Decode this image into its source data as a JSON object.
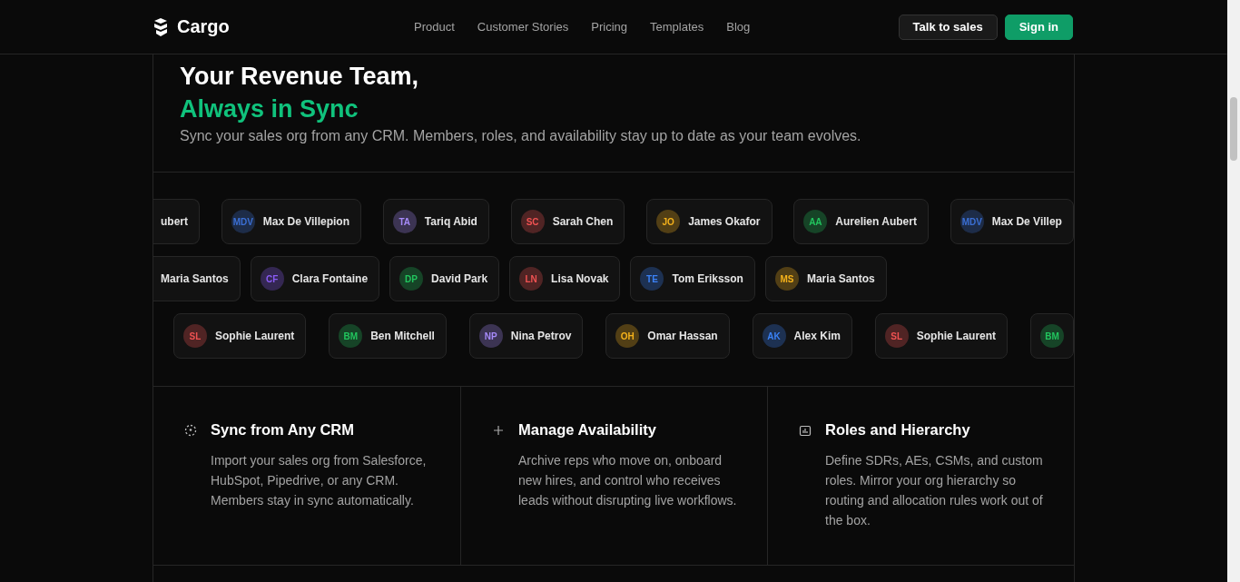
{
  "nav": {
    "brand": "Cargo",
    "links": [
      "Product",
      "Customer Stories",
      "Pricing",
      "Templates",
      "Blog"
    ],
    "buttons": [
      {
        "label": "Talk to sales",
        "kind": "secondary"
      },
      {
        "label": "Sign in",
        "kind": "primary"
      }
    ]
  },
  "hero": {
    "title": "Your Revenue Team,",
    "highlight": "Always in Sync",
    "subtitle": "Sync your sales org from any CRM. Members, roles, and availability stay up to date as your team evolves."
  },
  "member_rows": [
    [
      {
        "name": "ubert"
      },
      {
        "initials": "MDV",
        "name": "Max De Villepion",
        "color": "#3b6fd4"
      },
      {
        "initials": "TA",
        "name": "Tariq Abid",
        "color": "#a78bfa"
      },
      {
        "initials": "SC",
        "name": "Sarah Chen",
        "color": "#f05252"
      },
      {
        "initials": "JO",
        "name": "James Okafor",
        "color": "#f5b21b"
      },
      {
        "initials": "AA",
        "name": "Aurelien Aubert",
        "color": "#22c55e"
      },
      {
        "initials": "MDV",
        "name": "Max De Villep",
        "color": "#3b6fd4"
      }
    ],
    [
      {
        "name": "Maria Santos"
      },
      {
        "initials": "CF",
        "name": "Clara Fontaine",
        "color": "#8b5cf6"
      },
      {
        "initials": "DP",
        "name": "David Park",
        "color": "#22c55e"
      },
      {
        "initials": "LN",
        "name": "Lisa Novak",
        "color": "#f05252"
      },
      {
        "initials": "TE",
        "name": "Tom Eriksson",
        "color": "#3b82f6"
      },
      {
        "initials": "MS",
        "name": "Maria Santos",
        "color": "#f5b21b"
      }
    ],
    [
      {
        "initials": "SL",
        "name": "Sophie Laurent",
        "color": "#f05252"
      },
      {
        "initials": "BM",
        "name": "Ben Mitchell",
        "color": "#22c55e"
      },
      {
        "initials": "NP",
        "name": "Nina Petrov",
        "color": "#a78bfa"
      },
      {
        "initials": "OH",
        "name": "Omar Hassan",
        "color": "#f5b21b"
      },
      {
        "initials": "AK",
        "name": "Alex Kim",
        "color": "#3b82f6"
      },
      {
        "initials": "SL",
        "name": "Sophie Laurent",
        "color": "#f05252"
      },
      {
        "initials": "BM",
        "color": "#22c55e"
      }
    ]
  ],
  "features": [
    {
      "title": "Sync from Any CRM",
      "text": "Import your sales org from Salesforce, HubSpot, Pipedrive, or any CRM. Members stay in sync automatically."
    },
    {
      "title": "Manage Availability",
      "text": "Archive reps who move on, onboard new hires, and control who receives leads without disrupting live workflows."
    },
    {
      "title": "Roles and Hierarchy",
      "text": "Define SDRs, AEs, CSMs, and custom roles. Mirror your org hierarchy so routing and allocation rules work out of the box."
    }
  ]
}
